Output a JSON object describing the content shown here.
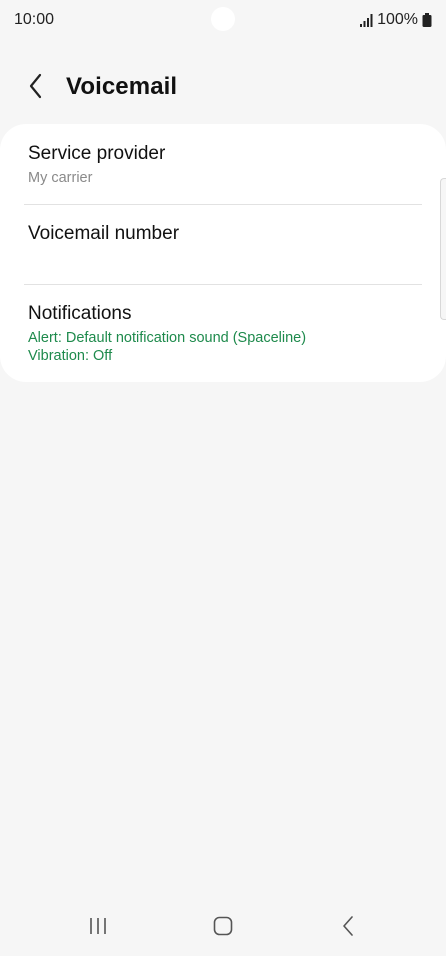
{
  "status_bar": {
    "time": "10:00",
    "battery_text": "100%",
    "icons": [
      "signal-icon",
      "battery-icon"
    ]
  },
  "header": {
    "title": "Voicemail",
    "back_icon": "chevron-left-icon"
  },
  "settings": {
    "items": [
      {
        "title": "Service provider",
        "subtitle": "My carrier"
      },
      {
        "title": "Voicemail number",
        "subtitle": ""
      },
      {
        "title": "Notifications",
        "alert_line": "Alert: Default notification sound (Spaceline)",
        "vibration_line": "Vibration: Off"
      }
    ]
  },
  "nav_bar": {
    "icons": [
      "recent-apps-icon",
      "home-icon",
      "back-icon"
    ]
  },
  "colors": {
    "background": "#f6f6f6",
    "card": "#ffffff",
    "accent_green": "#1e8a4c",
    "secondary_text": "#8a8a8a"
  }
}
